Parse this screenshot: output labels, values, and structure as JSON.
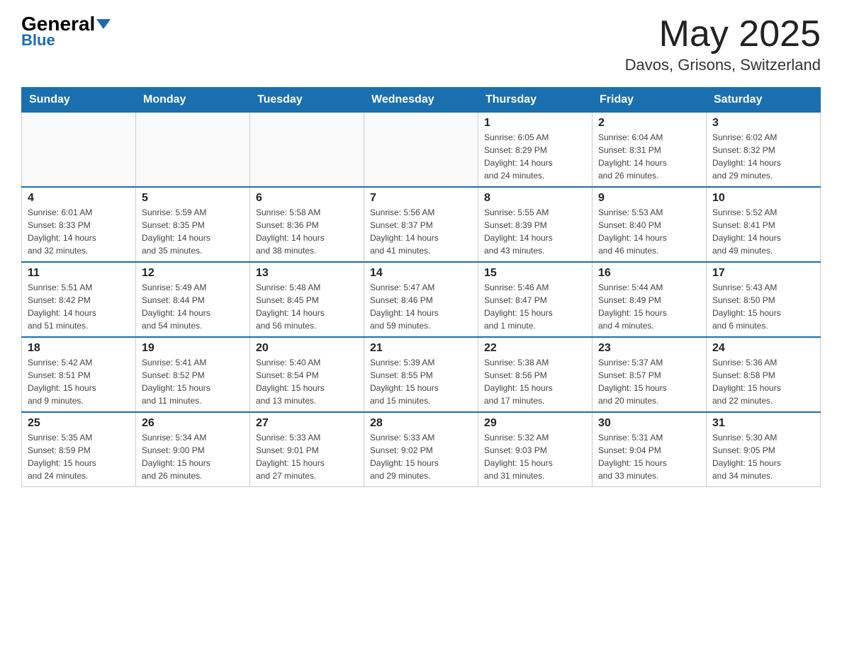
{
  "header": {
    "logo_general": "General",
    "logo_blue": "Blue",
    "title_month": "May 2025",
    "title_location": "Davos, Grisons, Switzerland"
  },
  "calendar": {
    "days_of_week": [
      "Sunday",
      "Monday",
      "Tuesday",
      "Wednesday",
      "Thursday",
      "Friday",
      "Saturday"
    ],
    "weeks": [
      [
        {
          "day": "",
          "info": ""
        },
        {
          "day": "",
          "info": ""
        },
        {
          "day": "",
          "info": ""
        },
        {
          "day": "",
          "info": ""
        },
        {
          "day": "1",
          "info": "Sunrise: 6:05 AM\nSunset: 8:29 PM\nDaylight: 14 hours\nand 24 minutes."
        },
        {
          "day": "2",
          "info": "Sunrise: 6:04 AM\nSunset: 8:31 PM\nDaylight: 14 hours\nand 26 minutes."
        },
        {
          "day": "3",
          "info": "Sunrise: 6:02 AM\nSunset: 8:32 PM\nDaylight: 14 hours\nand 29 minutes."
        }
      ],
      [
        {
          "day": "4",
          "info": "Sunrise: 6:01 AM\nSunset: 8:33 PM\nDaylight: 14 hours\nand 32 minutes."
        },
        {
          "day": "5",
          "info": "Sunrise: 5:59 AM\nSunset: 8:35 PM\nDaylight: 14 hours\nand 35 minutes."
        },
        {
          "day": "6",
          "info": "Sunrise: 5:58 AM\nSunset: 8:36 PM\nDaylight: 14 hours\nand 38 minutes."
        },
        {
          "day": "7",
          "info": "Sunrise: 5:56 AM\nSunset: 8:37 PM\nDaylight: 14 hours\nand 41 minutes."
        },
        {
          "day": "8",
          "info": "Sunrise: 5:55 AM\nSunset: 8:39 PM\nDaylight: 14 hours\nand 43 minutes."
        },
        {
          "day": "9",
          "info": "Sunrise: 5:53 AM\nSunset: 8:40 PM\nDaylight: 14 hours\nand 46 minutes."
        },
        {
          "day": "10",
          "info": "Sunrise: 5:52 AM\nSunset: 8:41 PM\nDaylight: 14 hours\nand 49 minutes."
        }
      ],
      [
        {
          "day": "11",
          "info": "Sunrise: 5:51 AM\nSunset: 8:42 PM\nDaylight: 14 hours\nand 51 minutes."
        },
        {
          "day": "12",
          "info": "Sunrise: 5:49 AM\nSunset: 8:44 PM\nDaylight: 14 hours\nand 54 minutes."
        },
        {
          "day": "13",
          "info": "Sunrise: 5:48 AM\nSunset: 8:45 PM\nDaylight: 14 hours\nand 56 minutes."
        },
        {
          "day": "14",
          "info": "Sunrise: 5:47 AM\nSunset: 8:46 PM\nDaylight: 14 hours\nand 59 minutes."
        },
        {
          "day": "15",
          "info": "Sunrise: 5:46 AM\nSunset: 8:47 PM\nDaylight: 15 hours\nand 1 minute."
        },
        {
          "day": "16",
          "info": "Sunrise: 5:44 AM\nSunset: 8:49 PM\nDaylight: 15 hours\nand 4 minutes."
        },
        {
          "day": "17",
          "info": "Sunrise: 5:43 AM\nSunset: 8:50 PM\nDaylight: 15 hours\nand 6 minutes."
        }
      ],
      [
        {
          "day": "18",
          "info": "Sunrise: 5:42 AM\nSunset: 8:51 PM\nDaylight: 15 hours\nand 9 minutes."
        },
        {
          "day": "19",
          "info": "Sunrise: 5:41 AM\nSunset: 8:52 PM\nDaylight: 15 hours\nand 11 minutes."
        },
        {
          "day": "20",
          "info": "Sunrise: 5:40 AM\nSunset: 8:54 PM\nDaylight: 15 hours\nand 13 minutes."
        },
        {
          "day": "21",
          "info": "Sunrise: 5:39 AM\nSunset: 8:55 PM\nDaylight: 15 hours\nand 15 minutes."
        },
        {
          "day": "22",
          "info": "Sunrise: 5:38 AM\nSunset: 8:56 PM\nDaylight: 15 hours\nand 17 minutes."
        },
        {
          "day": "23",
          "info": "Sunrise: 5:37 AM\nSunset: 8:57 PM\nDaylight: 15 hours\nand 20 minutes."
        },
        {
          "day": "24",
          "info": "Sunrise: 5:36 AM\nSunset: 8:58 PM\nDaylight: 15 hours\nand 22 minutes."
        }
      ],
      [
        {
          "day": "25",
          "info": "Sunrise: 5:35 AM\nSunset: 8:59 PM\nDaylight: 15 hours\nand 24 minutes."
        },
        {
          "day": "26",
          "info": "Sunrise: 5:34 AM\nSunset: 9:00 PM\nDaylight: 15 hours\nand 26 minutes."
        },
        {
          "day": "27",
          "info": "Sunrise: 5:33 AM\nSunset: 9:01 PM\nDaylight: 15 hours\nand 27 minutes."
        },
        {
          "day": "28",
          "info": "Sunrise: 5:33 AM\nSunset: 9:02 PM\nDaylight: 15 hours\nand 29 minutes."
        },
        {
          "day": "29",
          "info": "Sunrise: 5:32 AM\nSunset: 9:03 PM\nDaylight: 15 hours\nand 31 minutes."
        },
        {
          "day": "30",
          "info": "Sunrise: 5:31 AM\nSunset: 9:04 PM\nDaylight: 15 hours\nand 33 minutes."
        },
        {
          "day": "31",
          "info": "Sunrise: 5:30 AM\nSunset: 9:05 PM\nDaylight: 15 hours\nand 34 minutes."
        }
      ]
    ]
  }
}
